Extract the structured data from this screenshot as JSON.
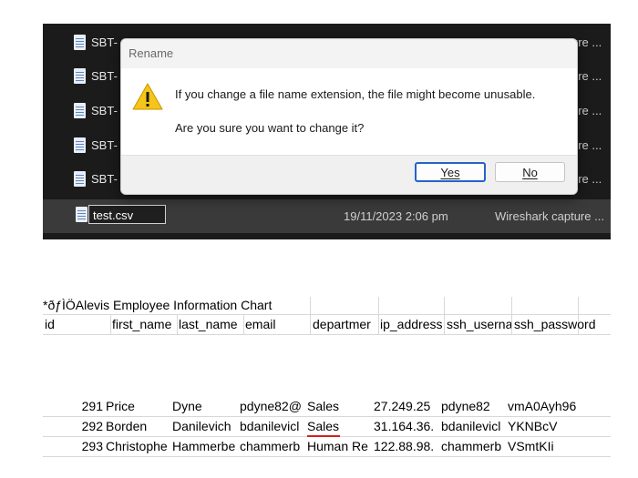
{
  "explorer": {
    "files": [
      {
        "name": "SBT-",
        "type": "ure ..."
      },
      {
        "name": "SBT-",
        "type": "ure ..."
      },
      {
        "name": "SBT-",
        "type": "ure ..."
      },
      {
        "name": "SBT-",
        "type": "ure ..."
      },
      {
        "name": "SBT-",
        "type": "ure ..."
      }
    ],
    "renaming": {
      "name_input": "test.csv",
      "date": "19/11/2023 2:06 pm",
      "type": "Wireshark capture ..."
    }
  },
  "dialog": {
    "title": "Rename",
    "message": "If you change a file name extension, the file might become unusable.",
    "question": "Are you sure you want to change it?",
    "yes_label": "Yes",
    "no_label": "No",
    "icon": "warning-icon"
  },
  "sheet": {
    "title": "*ðƒÌÖAlevis Employee Information Chart",
    "headers": [
      "id",
      "first_name",
      "last_name",
      "email",
      "departmer",
      "ip_address",
      "ssh_userna",
      "ssh_password"
    ],
    "rows": [
      [
        "291",
        "Price",
        "Dyne",
        "pdyne82@",
        "Sales",
        "27.249.25",
        "pdyne82",
        "vmA0Ayh96"
      ],
      [
        "292",
        "Borden",
        "Danilevich",
        "bdanilevicl",
        "Sales",
        "31.164.36.",
        "bdanilevicl",
        "YKNBcV"
      ],
      [
        "293",
        "Christophe",
        "Hammerbe",
        "chammerb",
        "Human Re",
        "122.88.98.",
        "chammerb",
        "VSmtKIi"
      ]
    ]
  },
  "colors": {
    "explorer_bg": "#1b1b1b",
    "dialog_accent": "#2563c9",
    "warning": "#f5c518",
    "annotation": "#d61f1f"
  }
}
